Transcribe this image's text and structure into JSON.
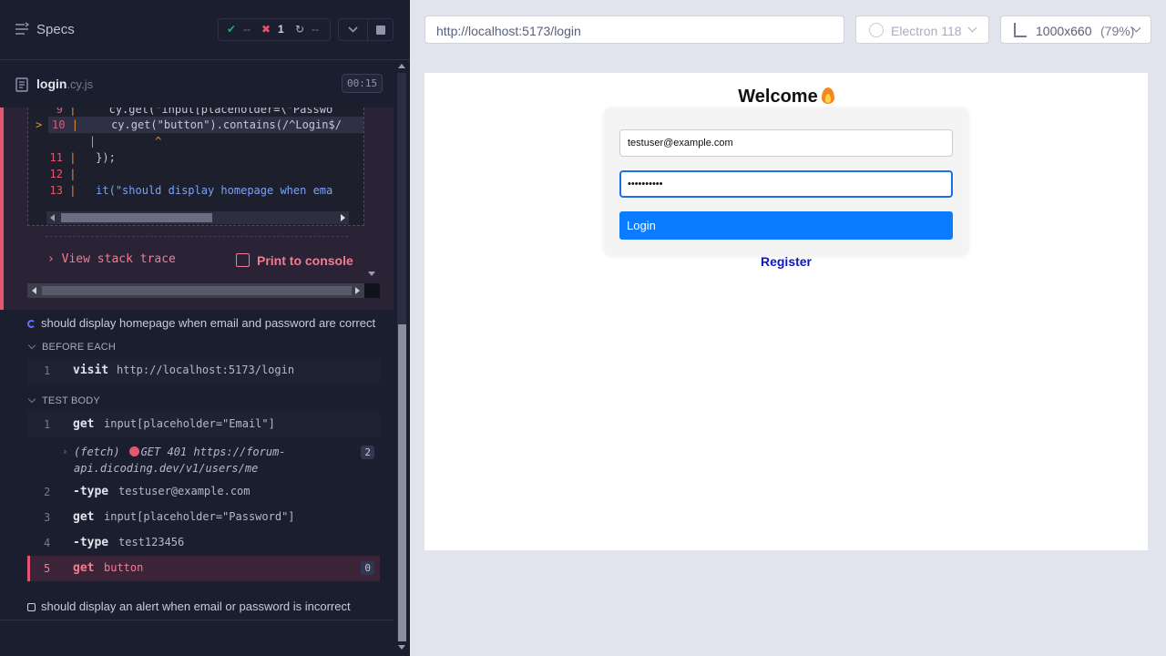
{
  "specs_header": {
    "title": "Specs",
    "passed_count": "--",
    "failed_count": "1",
    "pending_count": "--"
  },
  "spec_file": {
    "name": "login",
    "ext": ".cy.js",
    "duration": "00:15"
  },
  "error_code_frame": {
    "lines": [
      {
        "num": "9",
        "code": "cy.get(\"input[placeholder=\\\"Passwo"
      },
      {
        "num": "10",
        "code": "cy.get(\"button\").contains(/^Login$/"
      },
      {
        "num": "",
        "code": "^"
      },
      {
        "num": "11",
        "code": "});"
      },
      {
        "num": "12",
        "code": ""
      },
      {
        "num": "13",
        "code": "it(\"should display homepage when ema"
      }
    ],
    "view_stack_trace": "View stack trace",
    "print_to_console": "Print to console"
  },
  "tests": [
    {
      "title": "should display homepage when email and password are correct",
      "before_each_label": "BEFORE EACH",
      "before_each": [
        {
          "num": "1",
          "name": "visit",
          "arg": "http://localhost:5173/login"
        }
      ],
      "test_body_label": "TEST BODY",
      "test_body": [
        {
          "num": "1",
          "name": "get",
          "arg": "input[placeholder=\"Email\"]"
        },
        {
          "num": "2",
          "name": "-type",
          "arg": "testuser@example.com"
        },
        {
          "num": "3",
          "name": "get",
          "arg": "input[placeholder=\"Password\"]"
        },
        {
          "num": "4",
          "name": "-type",
          "arg": "test123456"
        },
        {
          "num": "5",
          "name": "get",
          "arg": "button",
          "badge": "0"
        }
      ],
      "fetch": {
        "label": "(fetch)",
        "status": "GET 401",
        "url": "https://forum-api.dicoding.dev/v1/users/me",
        "badge": "2"
      }
    },
    {
      "title": "should display an alert when email or password is incorrect"
    }
  ],
  "browser_toolbar": {
    "url": "http://localhost:5173/login",
    "browser": "Electron 118",
    "viewport": "1000x660",
    "zoom": "(79%)"
  },
  "app": {
    "welcome": "Welcome",
    "email_value": "testuser@example.com",
    "password_value": "••••••••••",
    "login_label": "Login",
    "register_label": "Register"
  },
  "colors": {
    "reporter_bg": "#1b1e2e",
    "fail_accent": "#e45770",
    "pass": "#1fa971",
    "login_button": "#0a7cff",
    "register_link": "#0a16c8"
  }
}
